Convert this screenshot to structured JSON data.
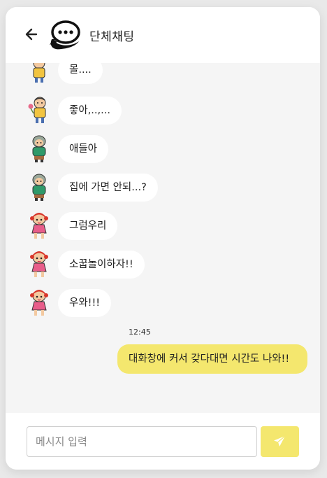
{
  "header": {
    "title": "단체채팅",
    "back_icon": "arrow-left-icon",
    "logo_icon": "chat-bubbles-icon"
  },
  "messages": [
    {
      "text": "몰....",
      "avatar": "yellow-shirt-boy-avatar"
    },
    {
      "text": "좋아,..,...",
      "avatar": "yellow-shirt-boy-avatar"
    },
    {
      "text": "애들아",
      "avatar": "green-shirt-grandma-avatar"
    },
    {
      "text": "집에 가면 안되...?",
      "avatar": "green-shirt-grandma-avatar"
    },
    {
      "text": "그럼우리",
      "avatar": "red-hair-girl-avatar"
    },
    {
      "text": "소꿉놀이하자!!",
      "avatar": "red-hair-girl-avatar"
    },
    {
      "text": "우와!!!",
      "avatar": "red-hair-girl-avatar"
    }
  ],
  "my_message": {
    "time": "12:45",
    "text": "대화창에 커서 갖다대면 시간도 나와!!"
  },
  "composer": {
    "placeholder": "메시지 입력",
    "value": "",
    "send_icon": "paper-plane-icon"
  },
  "colors": {
    "accent": "#f4e76e",
    "background": "#f5f5f5",
    "bubble": "#ffffff"
  }
}
